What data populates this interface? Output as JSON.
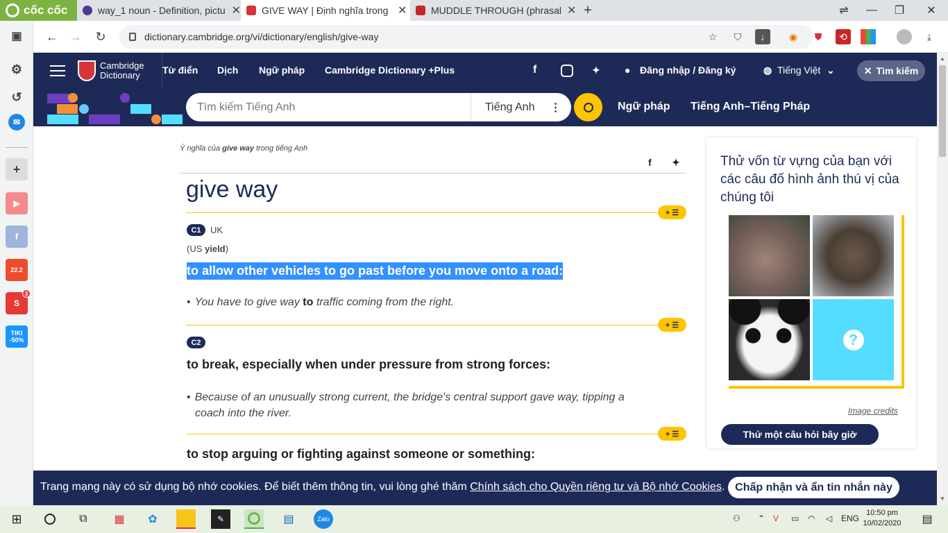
{
  "browser": {
    "logo_text": "cốc cốc",
    "tabs": [
      {
        "title": "way_1 noun - Definition, pictu",
        "active": false
      },
      {
        "title": "GIVE WAY | Định nghĩa trong",
        "active": true
      },
      {
        "title": "MUDDLE THROUGH (phrasal",
        "active": false
      }
    ],
    "new_tab": "+",
    "url": "dictionary.cambridge.org/vi/dictionary/english/give-way",
    "sidebar_badges": {
      "shopee": "22.2",
      "tiki_line1": "TIKI",
      "tiki_line2": "-50%",
      "notif": "3"
    }
  },
  "site": {
    "logo_line1": "Cambridge",
    "logo_line2": "Dictionary",
    "nav": [
      "Từ điển",
      "Dịch",
      "Ngữ pháp",
      "Cambridge Dictionary +Plus"
    ],
    "login": "Đăng nhập / Đăng ký",
    "language": "Tiếng Việt",
    "search_pill": "Tìm kiếm",
    "search_placeholder": "Tìm kiếm Tiếng Anh",
    "search_lang": "Tiếng Anh",
    "sub_nav": [
      "Ngữ pháp",
      "Tiếng Anh–Tiếng Pháp"
    ],
    "colors": {
      "navy": "#1d2a57",
      "yellow": "#fec400",
      "highlight": "#3390ff"
    }
  },
  "entry": {
    "crumb_prefix": "Ý nghĩa của ",
    "crumb_word": "give way",
    "crumb_suffix": " trong tiếng Anh",
    "headword": "give way",
    "sense1": {
      "level": "C1",
      "region": "UK",
      "us_prefix": "(US ",
      "us_word": "yield",
      "us_suffix": ")",
      "definition": "to allow other vehicles to go past before you move onto a road:",
      "example_a": "You have to give way ",
      "example_b": "to",
      "example_c": " traffic coming from the right."
    },
    "sense2": {
      "level": "C2",
      "definition": "to break, especially when under pressure from strong forces:",
      "example_line1": "Because of an unusually strong current, the bridge's central support gave way, tipping a",
      "example_line2": "coach into the river."
    },
    "sense3": {
      "definition": "to stop arguing or fighting against someone or something:"
    },
    "plus_icon": "+ ☰"
  },
  "quiz": {
    "title": "Thử vốn từ vựng của bạn với các câu đố hình ảnh thú vị của chúng tôi",
    "credits": "Image credits",
    "button": "Thử một câu hỏi bây giờ",
    "question_mark": "?"
  },
  "cookie": {
    "text": "Trang mạng này có sử dụng bộ nhớ cookies. Để biết thêm thông tin, vui lòng ghé thăm ",
    "link": "Chính sách cho Quyền riêng tư và Bộ nhớ Cookies",
    "end": ".",
    "accept": "Chấp nhận và ẩn tin nhắn này"
  },
  "taskbar": {
    "lang": "ENG",
    "time": "10:50 pm",
    "date": "10/02/2020"
  }
}
